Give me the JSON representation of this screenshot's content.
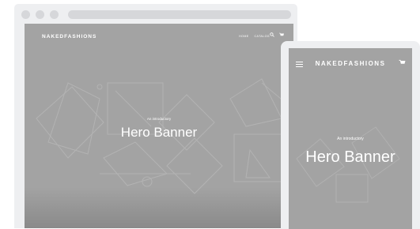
{
  "desktop": {
    "brand": "NAKEDFASHIONS",
    "nav": [
      "HOME",
      "CATALOG"
    ],
    "hero_subtitle": "An introductory",
    "hero_title": "Hero Banner",
    "icons": [
      "search-icon",
      "cart-icon"
    ]
  },
  "mobile": {
    "brand": "NAKEDFASHIONS",
    "hero_subtitle": "An introductory",
    "hero_title": "Hero Banner",
    "icons": [
      "hamburger-menu-icon",
      "cart-icon"
    ]
  },
  "colors": {
    "frame": "#eeeff1",
    "frame_placeholder": "#d6d7da",
    "screen": "#a3a3a3",
    "text": "#ffffff"
  }
}
